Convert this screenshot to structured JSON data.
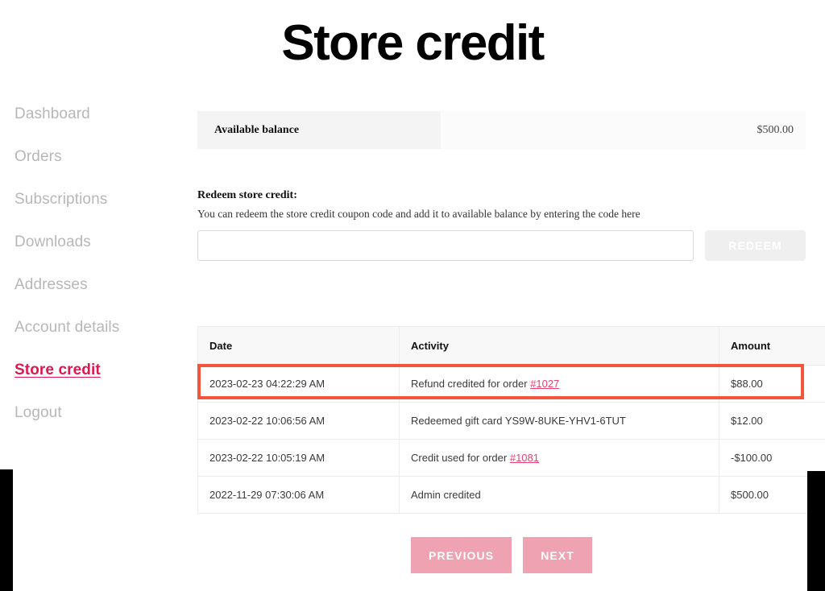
{
  "page": {
    "title": "Store credit"
  },
  "sidebar": {
    "items": [
      {
        "label": "Dashboard",
        "active": false
      },
      {
        "label": "Orders",
        "active": false
      },
      {
        "label": "Subscriptions",
        "active": false
      },
      {
        "label": "Downloads",
        "active": false
      },
      {
        "label": "Addresses",
        "active": false
      },
      {
        "label": "Account details",
        "active": false
      },
      {
        "label": "Store credit",
        "active": true
      },
      {
        "label": "Logout",
        "active": false
      }
    ],
    "active_color": "#e0164f",
    "inactive_color": "#b7b7b7"
  },
  "balance": {
    "label": "Available balance",
    "amount": "$500.00"
  },
  "redeem": {
    "heading": "Redeem store credit:",
    "description": "You can redeem the store credit coupon code and add it to available balance by entering the code here",
    "input_value": "",
    "input_placeholder": "",
    "button_label": "REDEEM"
  },
  "activity": {
    "columns": [
      "Date",
      "Activity",
      "Amount"
    ],
    "rows": [
      {
        "date": "2023-02-23 04:22:29 AM",
        "activity_prefix": "Refund credited for order ",
        "activity_link": "#1027",
        "amount": "$88.00",
        "highlighted": true
      },
      {
        "date": "2023-02-22 10:06:56 AM",
        "activity_prefix": "Redeemed gift card YS9W-8UKE-YHV1-6TUT",
        "activity_link": "",
        "amount": "$12.00",
        "highlighted": false
      },
      {
        "date": "2023-02-22 10:05:19 AM",
        "activity_prefix": "Credit used for order ",
        "activity_link": "#1081",
        "amount": "-$100.00",
        "highlighted": false
      },
      {
        "date": "2022-11-29 07:30:06 AM",
        "activity_prefix": "Admin credited",
        "activity_link": "",
        "amount": "$500.00",
        "highlighted": false
      }
    ],
    "highlight_color": "#f4553d",
    "link_color": "#e8436f"
  },
  "pagination": {
    "previous_label": "PREVIOUS",
    "next_label": "NEXT",
    "button_color": "#efa2b2"
  }
}
